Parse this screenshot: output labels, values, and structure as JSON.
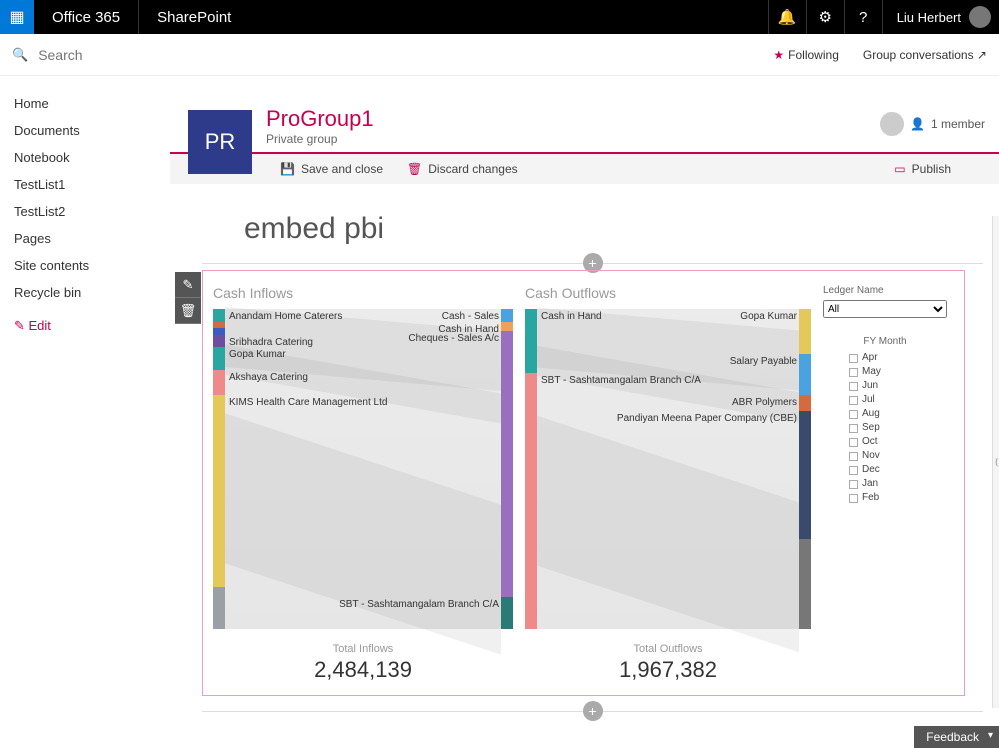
{
  "topbar": {
    "brand1": "Office 365",
    "brand2": "SharePoint",
    "user_name": "Liu Herbert"
  },
  "search": {
    "placeholder": "Search"
  },
  "header_links": {
    "following": "Following",
    "group_conversations": "Group conversations ↗"
  },
  "leftnav": {
    "items": [
      "Home",
      "Documents",
      "Notebook",
      "TestList1",
      "TestList2",
      "Pages",
      "Site contents",
      "Recycle bin"
    ],
    "edit_label": "Edit"
  },
  "group": {
    "tile_initials": "PR",
    "title": "ProGroup1",
    "subtitle": "Private group",
    "members_label": "1 member"
  },
  "ribbon": {
    "save_label": "Save and close",
    "discard_label": "Discard changes",
    "publish_label": "Publish"
  },
  "page_title": "embed pbi",
  "feedback_label": "Feedback",
  "filters": {
    "ledger_label": "Ledger Name",
    "ledger_value": "All",
    "month_header": "FY Month",
    "months": [
      "Apr",
      "May",
      "Jun",
      "Jul",
      "Aug",
      "Sep",
      "Oct",
      "Nov",
      "Dec",
      "Jan",
      "Feb"
    ]
  },
  "chart_data": [
    {
      "type": "sankey",
      "title": "Cash Inflows",
      "total_label": "Total Inflows",
      "total_value": "2,484,139",
      "left_nodes": [
        {
          "name": "Anandam Home Caterers",
          "weight": 0.04,
          "color": "#2aa6a0"
        },
        {
          "name": "",
          "weight": 0.02,
          "color": "#d36b3e"
        },
        {
          "name": "",
          "weight": 0.02,
          "color": "#3a5bbf"
        },
        {
          "name": "Sribhadra Catering",
          "weight": 0.04,
          "color": "#6a4f9e"
        },
        {
          "name": "Gopa Kumar",
          "weight": 0.07,
          "color": "#2aa6a0"
        },
        {
          "name": "Akshaya Catering",
          "weight": 0.08,
          "color": "#f08a8a"
        },
        {
          "name": "KIMS Health Care Management Ltd",
          "weight": 0.6,
          "color": "#e4c85a"
        },
        {
          "name": "",
          "weight": 0.13,
          "color": "#9aa0a6"
        }
      ],
      "right_nodes": [
        {
          "name": "Cash - Sales",
          "weight": 0.04,
          "color": "#4aa3e0"
        },
        {
          "name": "Cash in Hand",
          "weight": 0.03,
          "color": "#f0a05a"
        },
        {
          "name": "Cheques - Sales A/c",
          "weight": 0.83,
          "color": "#9a6fc0"
        },
        {
          "name": "SBT - Sashtamangalam Branch C/A",
          "weight": 0.1,
          "color": "#2a7a78"
        }
      ]
    },
    {
      "type": "sankey",
      "title": "Cash Outflows",
      "total_label": "Total Outflows",
      "total_value": "1,967,382",
      "left_nodes": [
        {
          "name": "Cash in Hand",
          "weight": 0.2,
          "color": "#2aa6a0"
        },
        {
          "name": "SBT - Sashtamangalam Branch C/A",
          "weight": 0.8,
          "color": "#f08a8a"
        }
      ],
      "right_nodes": [
        {
          "name": "Gopa Kumar",
          "weight": 0.14,
          "color": "#e4c85a"
        },
        {
          "name": "Salary Payable",
          "weight": 0.13,
          "color": "#4aa3e0"
        },
        {
          "name": "ABR Polymers",
          "weight": 0.05,
          "color": "#d36b3e"
        },
        {
          "name": "Pandiyan Meena Paper Company (CBE)",
          "weight": 0.4,
          "color": "#3a4a6a"
        },
        {
          "name": "",
          "weight": 0.28,
          "color": "#777"
        }
      ]
    }
  ]
}
